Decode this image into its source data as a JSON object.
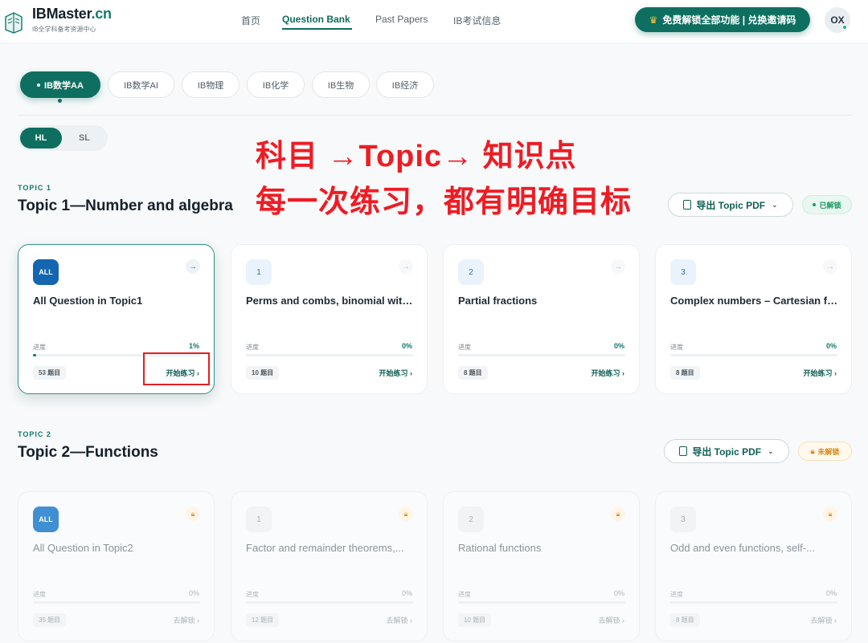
{
  "brand": {
    "title_main": "IBMaster",
    "title_suffix": ".cn",
    "subtitle": "IB全学科备考资源中心"
  },
  "nav": {
    "items": [
      "首页",
      "Question Bank",
      "Past Papers",
      "IB考试信息"
    ],
    "active": "Question Bank"
  },
  "promo": {
    "label": "免费解锁全部功能 | 兑换邀请码",
    "icon": "crown-icon"
  },
  "user": {
    "initials": "OX",
    "online_color": "#22b07d"
  },
  "subjects": [
    "IB数学AA",
    "IB数学AI",
    "IB物理",
    "IB化学",
    "IB生物",
    "IB经济"
  ],
  "levels": [
    "HL",
    "SL"
  ],
  "annotation": {
    "line1": "科目 →Topic→ 知识点",
    "line2": "每一次练习，都有明确目标"
  },
  "colors": {
    "accent": "#0e6f60",
    "annotation": "#ee1c24",
    "unlocked": "#1c9a63",
    "locked": "#d98a1b"
  },
  "labels": {
    "progress": "进度",
    "export": "导出 Topic PDF"
  },
  "topics": [
    {
      "kicker": "TOPIC 1",
      "title": "Topic 1—Number and algebra",
      "status": "已解锁",
      "cards": [
        {
          "num": "ALL",
          "title": "All Question in Topic1",
          "progress": "1%",
          "progress_value": 1,
          "count": "53 题目",
          "action": "开始练习 ›"
        },
        {
          "num": "1",
          "title": "Perms and combs, binomial with...",
          "progress": "0%",
          "progress_value": 0,
          "count": "10 题目",
          "action": "开始练习 ›"
        },
        {
          "num": "2",
          "title": "Partial fractions",
          "progress": "0%",
          "progress_value": 0,
          "count": "8 题目",
          "action": "开始练习 ›"
        },
        {
          "num": "3",
          "title": "Complex numbers – Cartesian for...",
          "progress": "0%",
          "progress_value": 0,
          "count": "8 题目",
          "action": "开始练习 ›"
        }
      ]
    },
    {
      "kicker": "TOPIC 2",
      "title": "Topic 2—Functions",
      "status": "未解锁",
      "cards": [
        {
          "num": "ALL",
          "title": "All Question in Topic2",
          "progress": "0%",
          "progress_value": 0,
          "count": "35 题目",
          "action": "去解锁 ›"
        },
        {
          "num": "1",
          "title": "Factor and remainder theorems,...",
          "progress": "0%",
          "progress_value": 0,
          "count": "12 题目",
          "action": "去解锁 ›"
        },
        {
          "num": "2",
          "title": "Rational functions",
          "progress": "0%",
          "progress_value": 0,
          "count": "10 题目",
          "action": "去解锁 ›"
        },
        {
          "num": "3",
          "title": "Odd and even functions, self-...",
          "progress": "0%",
          "progress_value": 0,
          "count": "8 题目",
          "action": "去解锁 ›"
        }
      ]
    }
  ]
}
